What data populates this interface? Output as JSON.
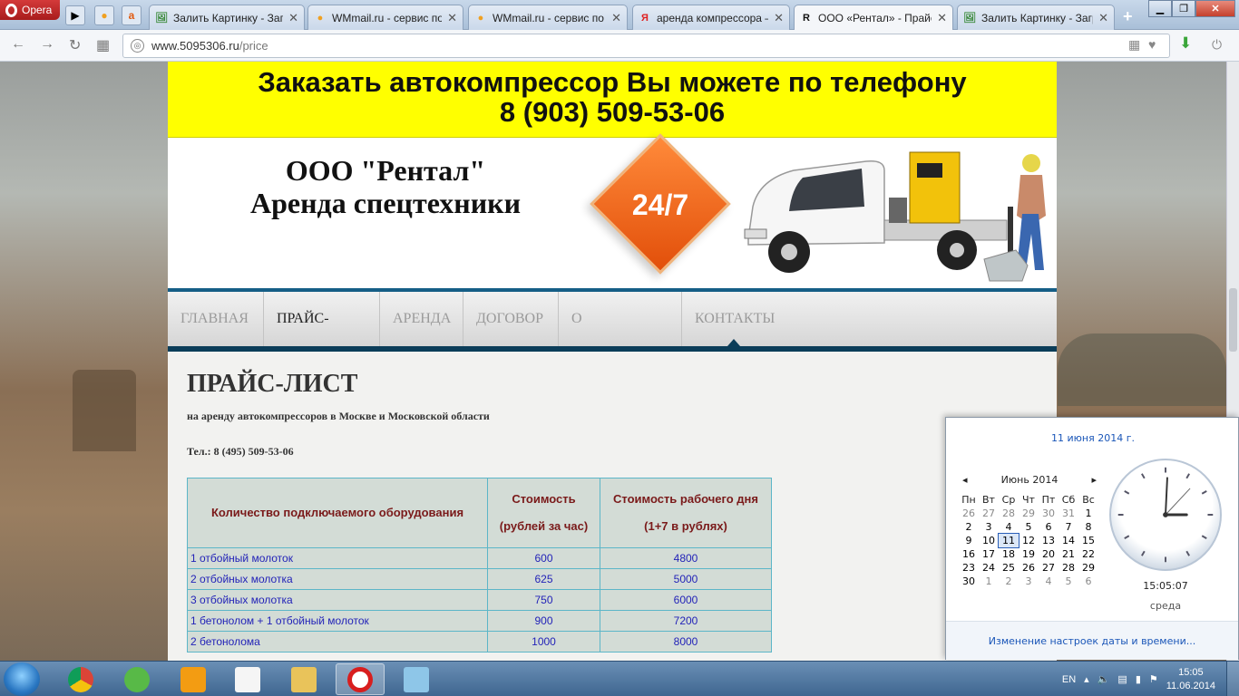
{
  "browser": {
    "menu_label": "Opera",
    "tabs": [
      {
        "title": "Залить Картинку - Загр",
        "fav": "🖼",
        "fav_color": "#3b8a3b"
      },
      {
        "title": "WMmail.ru - сервис по",
        "fav": "●",
        "fav_color": "#f0a020"
      },
      {
        "title": "WMmail.ru - сервис по",
        "fav": "●",
        "fav_color": "#f0a020"
      },
      {
        "title": "аренда компрессора –",
        "fav": "Я",
        "fav_color": "#e02020"
      },
      {
        "title": "ООО «Рентал» - Прайс",
        "fav": "R",
        "fav_color": "#111111"
      },
      {
        "title": "Залить Картинку - Загр",
        "fav": "🖼",
        "fav_color": "#3b8a3b"
      }
    ],
    "address_host": "www.5095306.ru",
    "address_path": "/price"
  },
  "site": {
    "banner_line1": "Заказать автокомпрессор Вы можете по телефону",
    "banner_line2": "8 (903) 509-53-06",
    "company_line1": "ООО \"Рентал\"",
    "company_line2": "Аренда спецтехники",
    "badge_text": "24/7",
    "menu": [
      "ГЛАВНАЯ",
      "ПРАЙС-ЛИСТ",
      "АРЕНДА",
      "ДОГОВОР",
      "О КОМПАНИИ",
      "КОНТАКТЫ"
    ],
    "page_title": "ПРАЙС-ЛИСТ",
    "subtitle": "на аренду автокомпрессоров в Москве и Московской области",
    "phone": "Тел.: 8 (495) 509-53-06",
    "table": {
      "col1": "Количество подключаемого оборудования",
      "col2_a": "Стоимость",
      "col2_b": "(рублей за час)",
      "col3_a": "Стоимость рабочего дня",
      "col3_b": "(1+7 в рублях)",
      "rows": [
        [
          "1 отбойный молоток",
          "600",
          "4800"
        ],
        [
          "2 отбойных молотка",
          "625",
          "5000"
        ],
        [
          "3 отбойных молотка",
          "750",
          "6000"
        ],
        [
          "1 бетонолом + 1 отбойный молоток",
          "900",
          "7200"
        ],
        [
          "2 бетонолома",
          "1000",
          "8000"
        ]
      ]
    }
  },
  "calendar": {
    "full_date": "11 июня 2014 г.",
    "month": "Июнь 2014",
    "weekdays": [
      "Пн",
      "Вт",
      "Ср",
      "Чт",
      "Пт",
      "Сб",
      "Вс"
    ],
    "weeks": [
      [
        "26",
        "27",
        "28",
        "29",
        "30",
        "31",
        "1"
      ],
      [
        "2",
        "3",
        "4",
        "5",
        "6",
        "7",
        "8"
      ],
      [
        "9",
        "10",
        "11",
        "12",
        "13",
        "14",
        "15"
      ],
      [
        "16",
        "17",
        "18",
        "19",
        "20",
        "21",
        "22"
      ],
      [
        "23",
        "24",
        "25",
        "26",
        "27",
        "28",
        "29"
      ],
      [
        "30",
        "1",
        "2",
        "3",
        "4",
        "5",
        "6"
      ]
    ],
    "today": "11",
    "time": "15:05:07",
    "weekday": "среда",
    "settings_link": "Изменение настроек даты и времени..."
  },
  "taskbar": {
    "lang": "EN",
    "time": "15:05",
    "date": "11.06.2014"
  }
}
